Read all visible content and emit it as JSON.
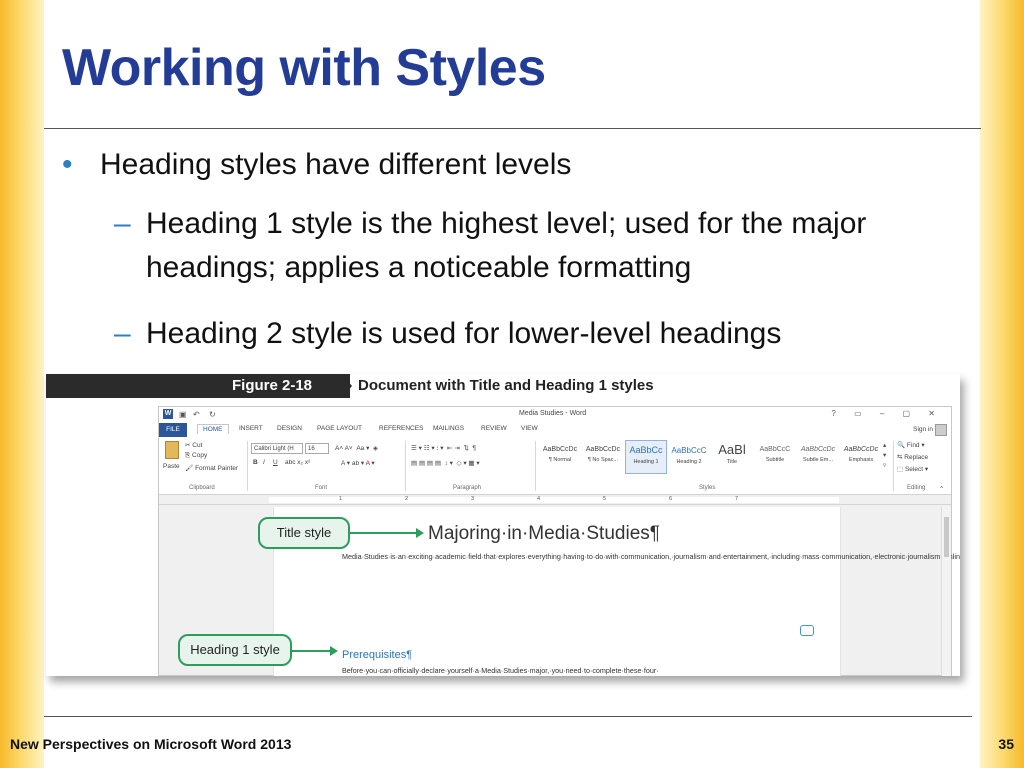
{
  "slide": {
    "title": "Working with Styles",
    "bullets": {
      "level1": "Heading styles have different levels",
      "level2": [
        "Heading 1 style is the highest level; used for the major headings; applies a noticeable formatting",
        "Heading 2 style is used for lower-level headings"
      ]
    },
    "bullet_glyph": "•",
    "dash_glyph": "–",
    "footer": "New Perspectives on Microsoft Word 2013",
    "page_number": "35"
  },
  "figure": {
    "label": "Figure 2-18",
    "caption": "Document with Title and Heading 1 styles",
    "callouts": {
      "title_style": "Title style",
      "heading1_style": "Heading 1 style"
    }
  },
  "word": {
    "window_title": "Media Studies - Word",
    "sign_in": "Sign in",
    "tabs": [
      "FILE",
      "HOME",
      "INSERT",
      "DESIGN",
      "PAGE LAYOUT",
      "REFERENCES",
      "MAILINGS",
      "REVIEW",
      "VIEW"
    ],
    "clipboard": {
      "paste": "Paste",
      "cut": "Cut",
      "copy": "Copy",
      "format_painter": "Format Painter",
      "label": "Clipboard"
    },
    "font": {
      "name": "Calibri Light (H",
      "size": "16",
      "label": "Font"
    },
    "paragraph_label": "Paragraph",
    "styles_label": "Styles",
    "styles": [
      {
        "sample": "AaBbCcDc",
        "name": "¶ Normal"
      },
      {
        "sample": "AaBbCcDc",
        "name": "¶ No Spac..."
      },
      {
        "sample": "AaBbCc",
        "name": "Heading 1"
      },
      {
        "sample": "AaBbCcC",
        "name": "Heading 2"
      },
      {
        "sample": "AaBl",
        "name": "Title"
      },
      {
        "sample": "AaBbCcC",
        "name": "Subtitle"
      },
      {
        "sample": "AaBbCcDc",
        "name": "Subtle Em..."
      },
      {
        "sample": "AaBbCcDc",
        "name": "Emphasis"
      }
    ],
    "editing": {
      "find": "Find",
      "replace": "Replace",
      "select": "Select",
      "label": "Editing"
    },
    "ruler_numbers": [
      "1",
      "2",
      "3",
      "4",
      "5",
      "6",
      "7"
    ],
    "document": {
      "title": "Majoring·in·Media·Studies¶",
      "paragraph": "Media·Studies·is·an·exciting·academic·field·that·explores·everything·having·to·do·with·communication,·journalism·and·entertainment,·including·mass·communication,·electronic·journalism,·online·media,·film,·and·television.·In·your·Media·Studies·classes,·you·will·approach·topics·from·varying·perspectives,·and·take·classes·in·many·different·departments.·For·example,·you·might·take·an·English·class·that·focuses·on·literature·and·popular·culture,·or·a·history·class·that·focuses·on·the·rise·of·the·modern·city.·Other·classes·might·bring·you·to·the·Psychology,·Economics,·or·Political·Science·departments,·just·to·name·a·few.¶",
      "heading1": "Prerequisites¶",
      "paragraph2": "Before·you·can·officially·declare·yourself·a·Media·Studies·major,·you·need·to·complete·these·four·"
    }
  },
  "colors": {
    "title_blue": "#233d96",
    "accent_blue": "#2c7fc2",
    "callout_green": "#2e9d5c",
    "side_bar_gold": "#f6b92a",
    "word_blue": "#2b579a"
  }
}
